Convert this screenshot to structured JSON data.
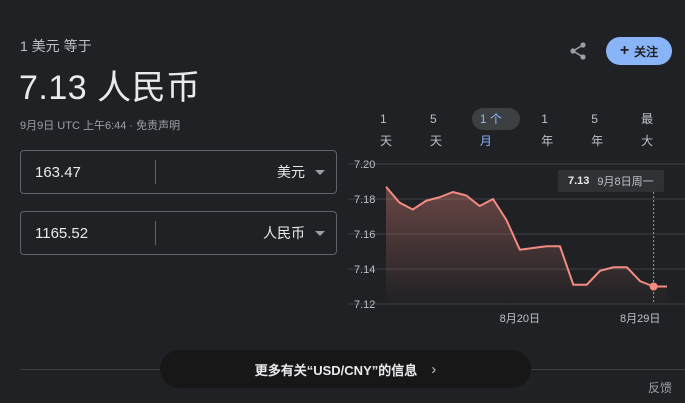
{
  "header": {
    "subtitle": "1 美元 等于",
    "value": "7.13 人民币",
    "timestamp": "9月9日 UTC 上午6:44 · 免责声明"
  },
  "actions": {
    "share_icon": "share-icon",
    "follow_label": "关注",
    "follow_icon": "plus-icon"
  },
  "converter": {
    "from": {
      "amount": "163.47",
      "currency": "美元"
    },
    "to": {
      "amount": "1165.52",
      "currency": "人民币"
    }
  },
  "range_tabs": [
    {
      "label": "1 天",
      "active": false
    },
    {
      "label": "5 天",
      "active": false
    },
    {
      "label": "1 个月",
      "active": true
    },
    {
      "label": "1 年",
      "active": false
    },
    {
      "label": "5 年",
      "active": false
    },
    {
      "label": "最大",
      "active": false
    }
  ],
  "tooltip": {
    "value": "7.13",
    "date": "9月8日周一"
  },
  "chart_data": {
    "type": "area",
    "title": "",
    "xlabel": "",
    "ylabel": "",
    "ylim": [
      7.12,
      7.2
    ],
    "yticks": [
      "7.20",
      "7.18",
      "7.16",
      "7.14",
      "7.12"
    ],
    "xtick_labels": [
      {
        "label": "8月20日",
        "index": 10
      },
      {
        "label": "8月29日",
        "index": 19
      }
    ],
    "grid": true,
    "line_color": "#f28b82",
    "series": [
      {
        "values": [
          7.187,
          7.178,
          7.174,
          7.179,
          7.181,
          7.184,
          7.182,
          7.176,
          7.18,
          7.168,
          7.151,
          7.152,
          7.153,
          7.153,
          7.131,
          7.131,
          7.139,
          7.141,
          7.141,
          7.133,
          7.13,
          7.13
        ]
      }
    ],
    "highlight_index": 20
  },
  "footer": {
    "more_info": "更多有关“USD/CNY”的信息",
    "chevron": "›",
    "feedback": "反馈"
  }
}
